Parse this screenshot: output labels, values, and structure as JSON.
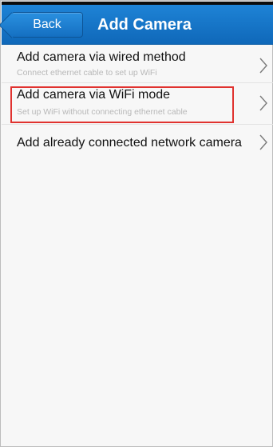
{
  "header": {
    "back_label": "Back",
    "title": "Add Camera"
  },
  "options": [
    {
      "title": "Add camera via wired method",
      "subtitle": "Connect ethernet cable to set up WiFi",
      "icon": "chevron-right-icon"
    },
    {
      "title": "Add camera via WiFi mode",
      "subtitle": "Set up WiFi without connecting ethernet cable",
      "icon": "chevron-right-icon",
      "highlighted": true
    },
    {
      "title": "Add already connected network camera",
      "subtitle": "",
      "icon": "chevron-right-icon"
    }
  ],
  "colors": {
    "navbar": "#1478c9",
    "highlight_border": "#e0322f"
  }
}
